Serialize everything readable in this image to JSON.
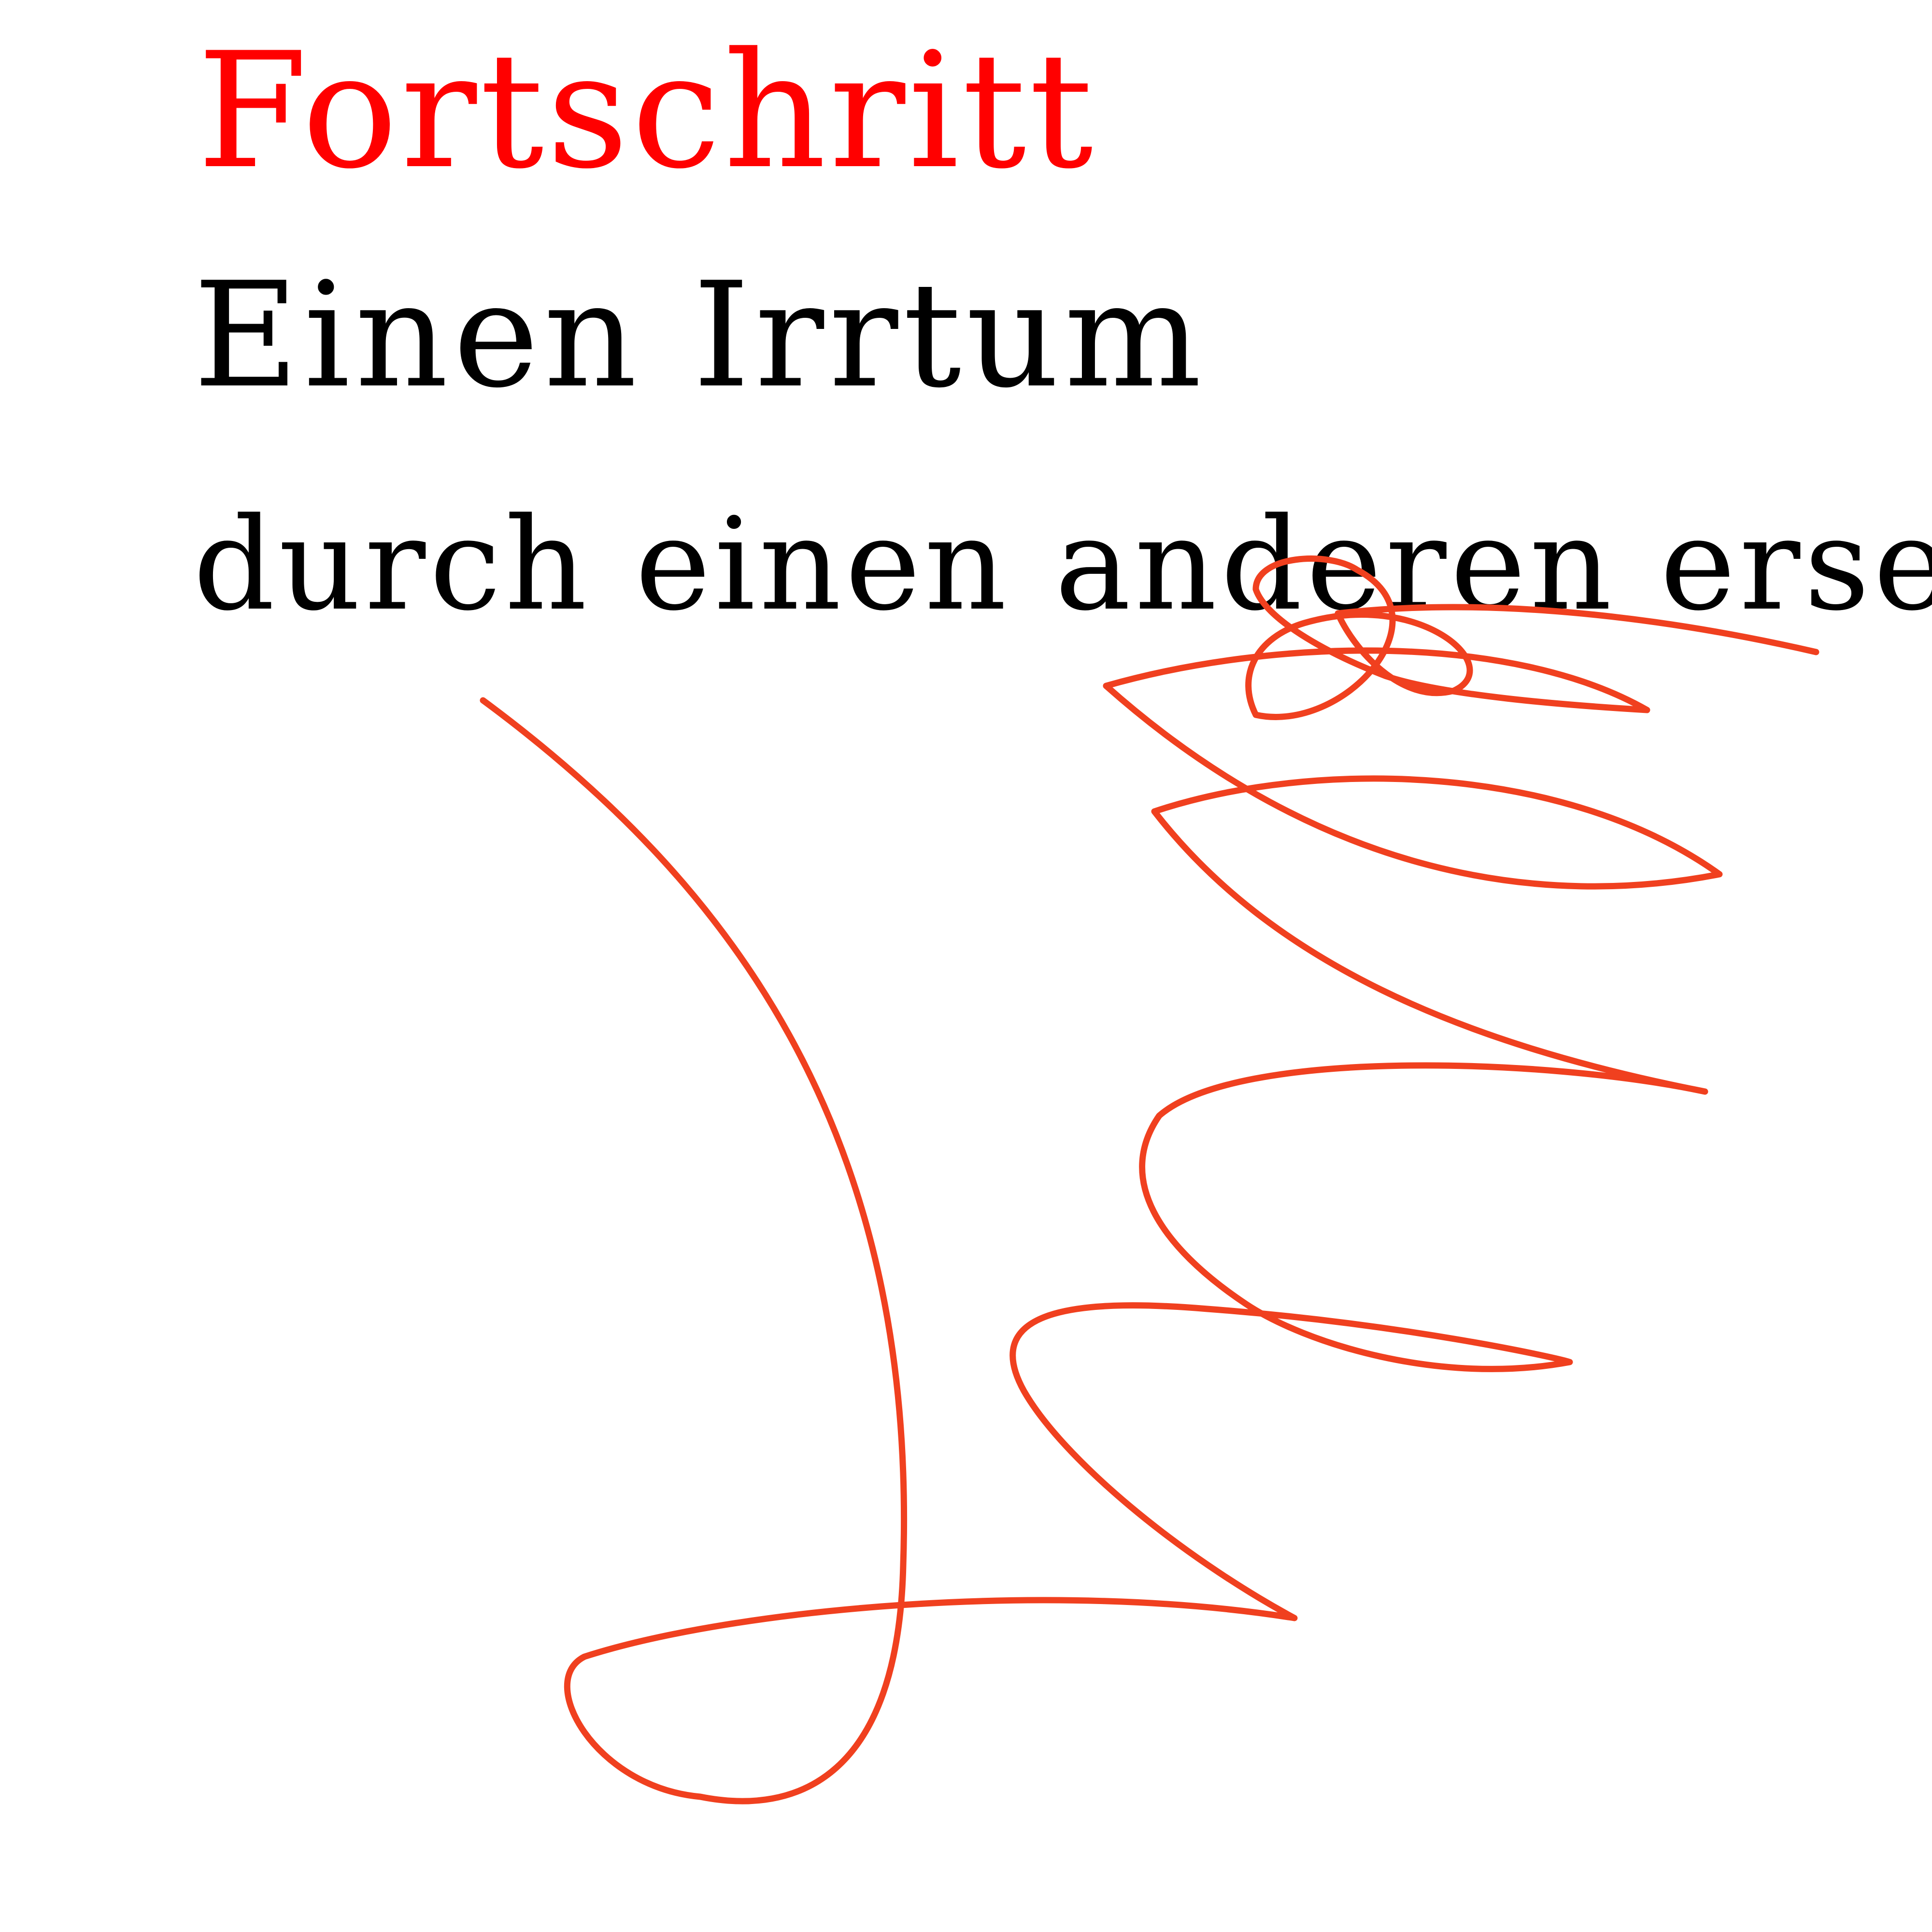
{
  "text": {
    "title": "Fortschritt",
    "line1": "Einen Irrtum",
    "line2": "durch einen anderen ersetzen."
  },
  "colors": {
    "background": "#ffffff",
    "title": "#ff0000",
    "body_text": "#000000",
    "scribble": "#f0401f"
  }
}
